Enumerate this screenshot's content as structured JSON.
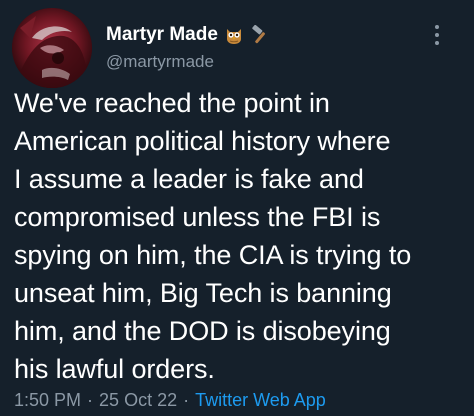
{
  "author": {
    "display_name": "Martyr Made",
    "handle": "@martyrmade",
    "name_emoji": [
      "owl-emoji",
      "hammer-emoji"
    ]
  },
  "tweet": {
    "lines": [
      "We've reached the point in",
      "American political history where",
      "I assume a leader is fake and",
      "compromised unless the FBI is",
      "spying on him, the CIA is trying to",
      "unseat him, Big Tech is banning",
      "him, and the DOD is disobeying",
      "his lawful orders."
    ]
  },
  "meta": {
    "time": "1:50 PM",
    "separator": "·",
    "date": "25 Oct 22",
    "app": "Twitter Web App"
  },
  "colors": {
    "background": "#15202b",
    "text": "#ffffff",
    "secondary": "#8b98a5",
    "link": "#1d9bf0"
  }
}
